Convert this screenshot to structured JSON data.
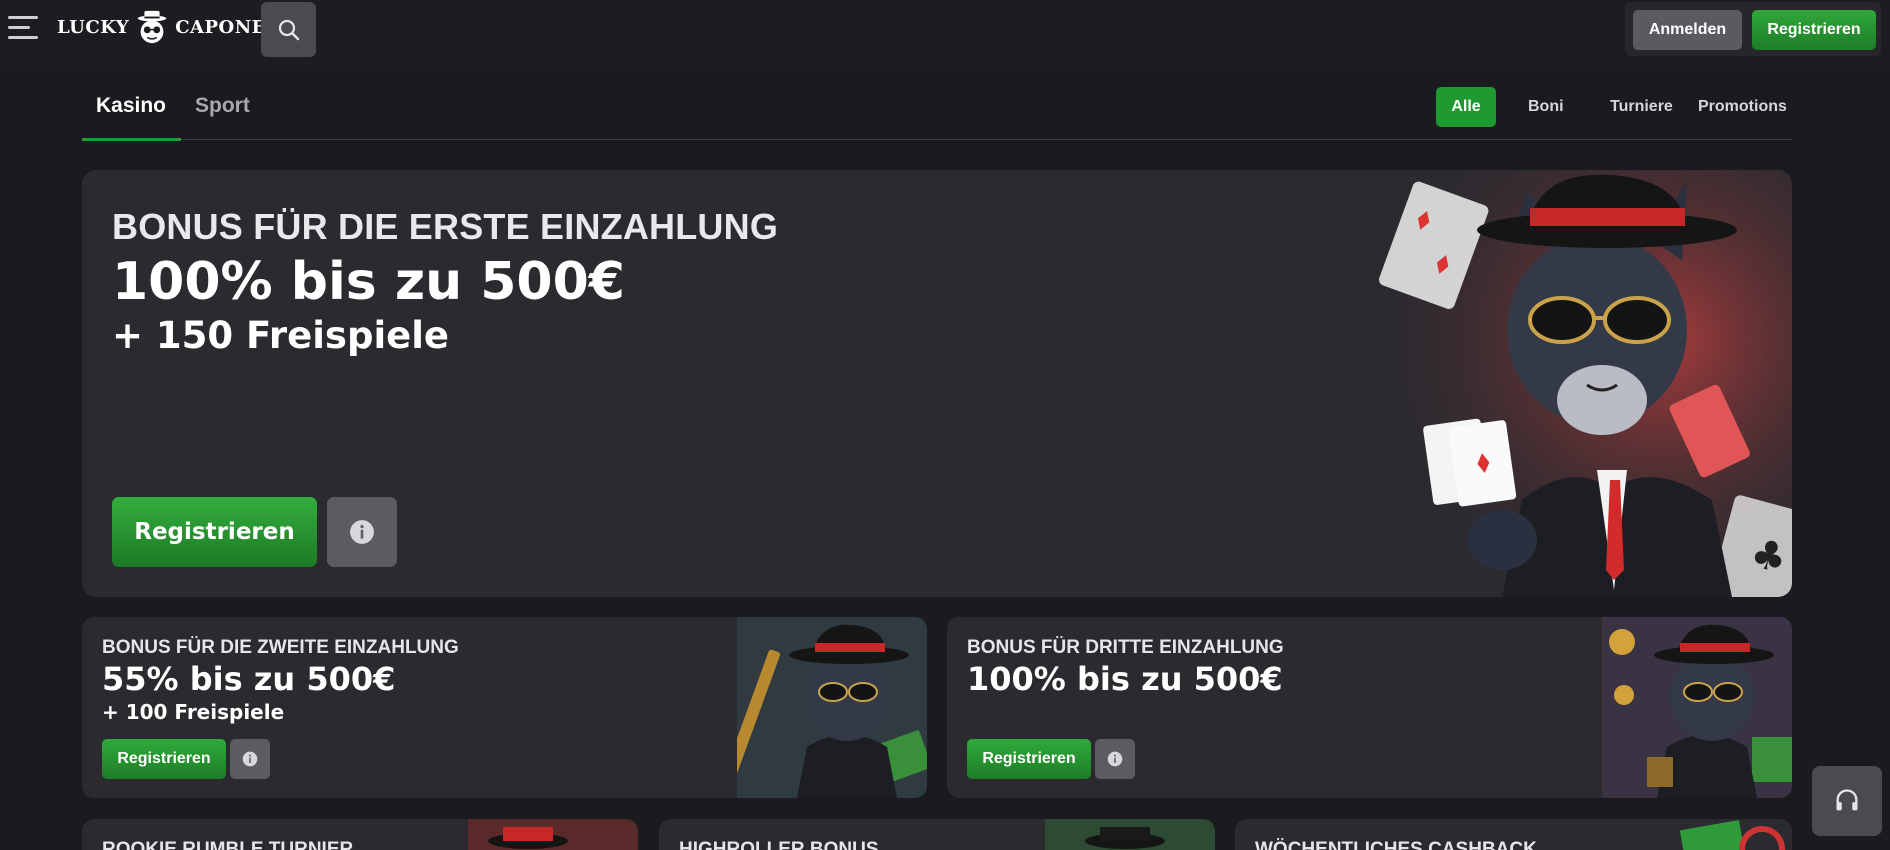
{
  "header": {
    "logo": {
      "word1": "LUCKY",
      "word2": "CAPONE"
    },
    "login_label": "Anmelden",
    "register_label": "Registrieren"
  },
  "nav": {
    "tabs": [
      {
        "label": "Kasino",
        "active": true
      },
      {
        "label": "Sport",
        "active": false
      }
    ],
    "filters": [
      {
        "label": "Alle",
        "active": true
      },
      {
        "label": "Boni",
        "active": false
      },
      {
        "label": "Turniere",
        "active": false
      },
      {
        "label": "Promotions",
        "active": false
      }
    ]
  },
  "hero": {
    "kicker": "BONUS FÜR DIE ERSTE EINZAHLUNG",
    "title": "100% bis zu 500€",
    "subtitle": "+ 150 Freispiele",
    "register_label": "Registrieren"
  },
  "cards": [
    {
      "kicker": "BONUS FÜR DIE ZWEITE EINZAHLUNG",
      "title": "55% bis zu 500€",
      "subtitle": "+ 100 Freispiele",
      "register_label": "Registrieren"
    },
    {
      "kicker": "BONUS FÜR DRITTE EINZAHLUNG",
      "title": "100% bis zu 500€",
      "subtitle": "",
      "register_label": "Registrieren"
    }
  ],
  "bottom_cards": [
    {
      "title": "ROOKIE RUMBLE TURNIER"
    },
    {
      "title": "HIGHROLLER BONUS"
    },
    {
      "title": "WÖCHENTLICHES CASHBACK"
    }
  ],
  "icons": {
    "menu": "hamburger-icon",
    "search": "search-icon",
    "info": "info-icon",
    "support": "headset-icon"
  },
  "colors": {
    "background": "#1b1b1f",
    "card": "#2a2a2f",
    "accent_green": "#1f9a30",
    "secondary_button": "#5a5a61"
  }
}
